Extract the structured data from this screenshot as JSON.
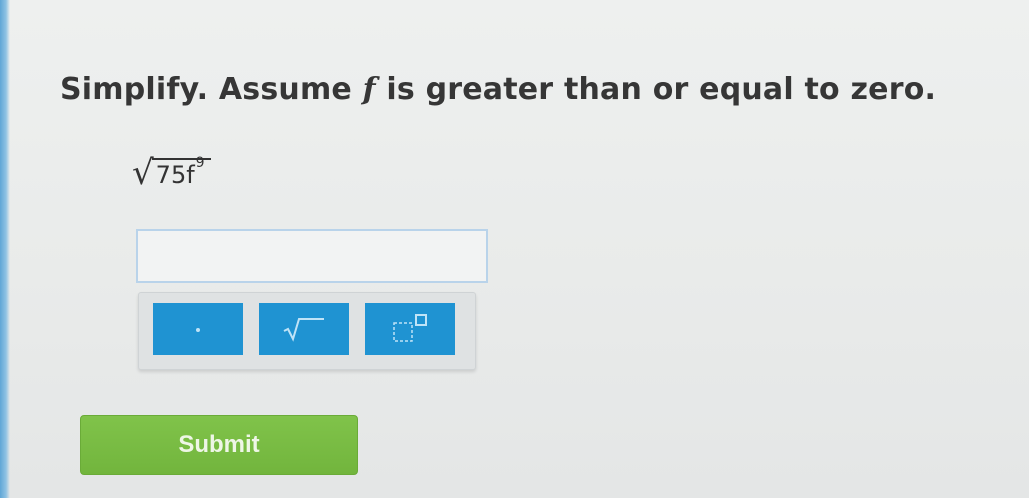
{
  "question": {
    "prefix": "Simplify. Assume ",
    "variable": "f",
    "suffix": " is greater than or equal to zero."
  },
  "expression": {
    "radicand_base": "75f",
    "radicand_exponent": "9"
  },
  "answer": {
    "value": "",
    "placeholder": ""
  },
  "keypad": {
    "keys": [
      {
        "name": "multiplication-dot",
        "symbol": "·"
      },
      {
        "name": "square-root",
        "symbol": "√"
      },
      {
        "name": "exponent",
        "symbol": "□"
      }
    ]
  },
  "submit": {
    "label": "Submit"
  },
  "colors": {
    "key_blue": "#1f93d2",
    "submit_green": "#78bb43",
    "input_border": "#b9d3ea"
  }
}
